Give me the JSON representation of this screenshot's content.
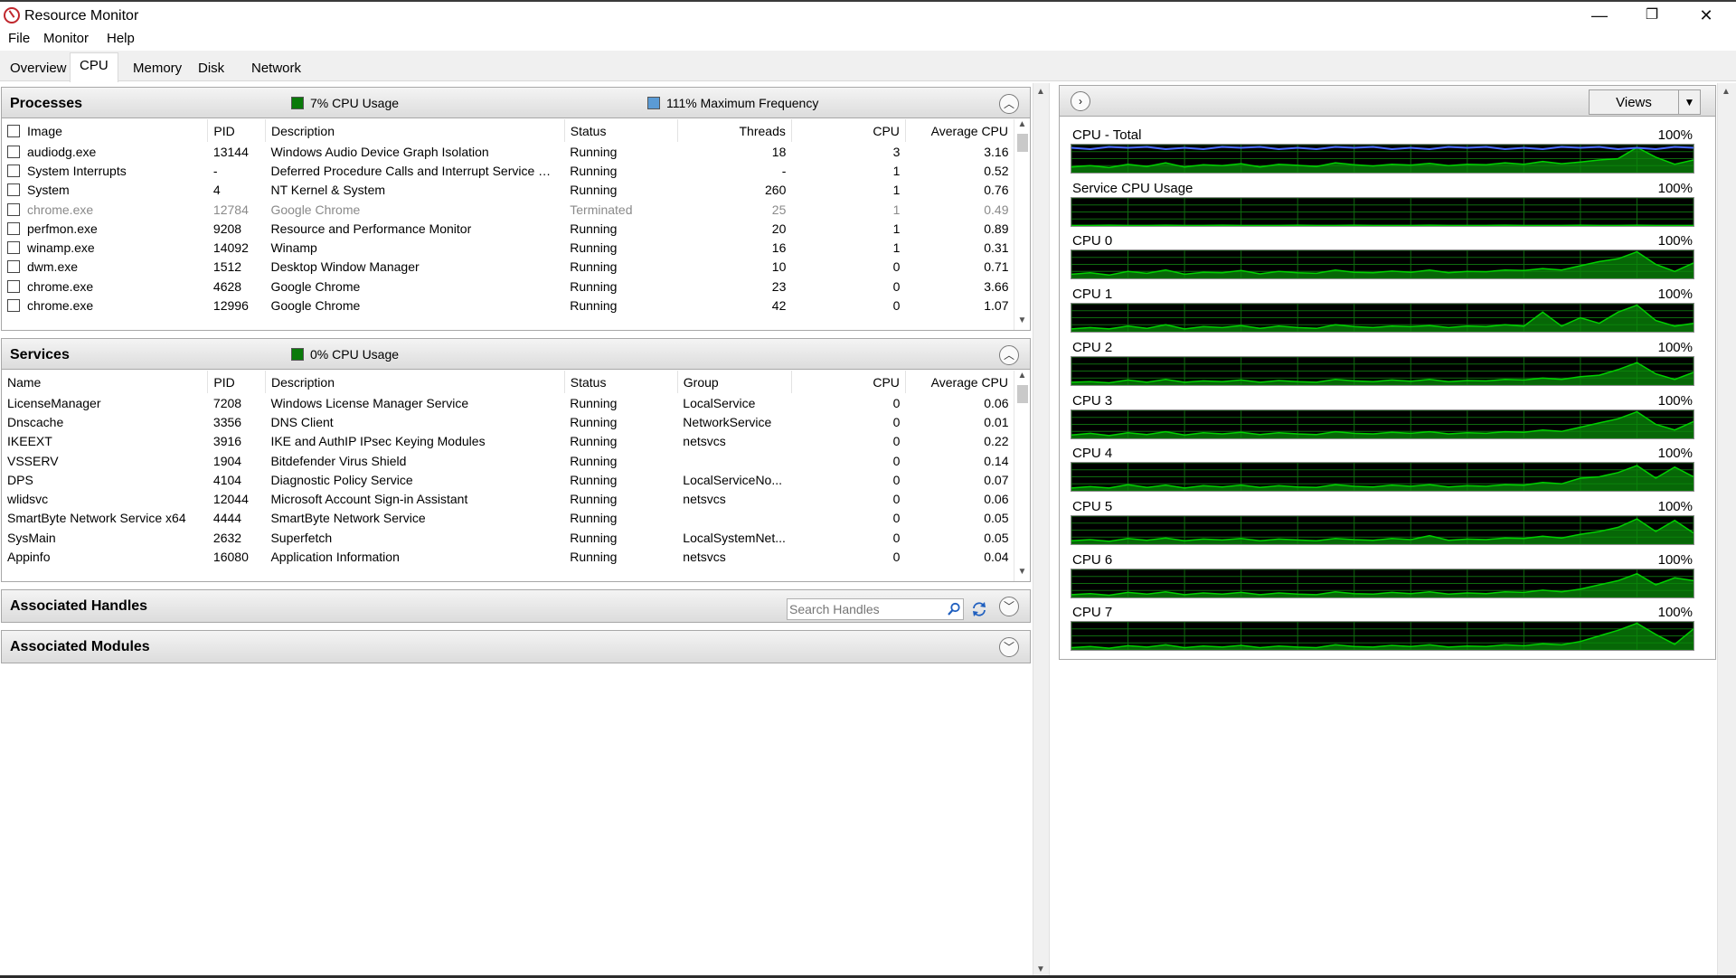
{
  "window": {
    "title": "Resource Monitor",
    "minimize": "—",
    "restore": "❐",
    "close": "✕"
  },
  "menu": [
    "File",
    "Monitor",
    "Help"
  ],
  "tabs": [
    "Overview",
    "CPU",
    "Memory",
    "Disk",
    "Network"
  ],
  "active_tab": "CPU",
  "colors": {
    "cpu_usage_box": "#0a7a0a",
    "max_freq_box": "#5b9bd5",
    "graph_line_green": "#00d000",
    "graph_line_blue": "#4a6cff",
    "graph_grid": "#0f6b0f"
  },
  "processes": {
    "title": "Processes",
    "cpu_usage": "7% CPU Usage",
    "max_frequency": "111% Maximum Frequency",
    "columns": [
      "Image",
      "PID",
      "Description",
      "Status",
      "Threads",
      "CPU",
      "Average CPU"
    ],
    "rows": [
      [
        "audiodg.exe",
        "13144",
        "Windows Audio Device Graph Isolation",
        "Running",
        "18",
        "3",
        "3.16"
      ],
      [
        "System Interrupts",
        "-",
        "Deferred Procedure Calls and Interrupt Service Rou...",
        "Running",
        "-",
        "1",
        "0.52"
      ],
      [
        "System",
        "4",
        "NT Kernel & System",
        "Running",
        "260",
        "1",
        "0.76"
      ],
      [
        "chrome.exe",
        "12784",
        "Google Chrome",
        "Terminated",
        "25",
        "1",
        "0.49"
      ],
      [
        "perfmon.exe",
        "9208",
        "Resource and Performance Monitor",
        "Running",
        "20",
        "1",
        "0.89"
      ],
      [
        "winamp.exe",
        "14092",
        "Winamp",
        "Running",
        "16",
        "1",
        "0.31"
      ],
      [
        "dwm.exe",
        "1512",
        "Desktop Window Manager",
        "Running",
        "10",
        "0",
        "0.71"
      ],
      [
        "chrome.exe",
        "4628",
        "Google Chrome",
        "Running",
        "23",
        "0",
        "3.66"
      ],
      [
        "chrome.exe",
        "12996",
        "Google Chrome",
        "Running",
        "42",
        "0",
        "1.07"
      ]
    ]
  },
  "services": {
    "title": "Services",
    "cpu_usage": "0% CPU Usage",
    "columns": [
      "Name",
      "PID",
      "Description",
      "Status",
      "Group",
      "CPU",
      "Average CPU"
    ],
    "rows": [
      [
        "LicenseManager",
        "7208",
        "Windows License Manager Service",
        "Running",
        "LocalService",
        "0",
        "0.06"
      ],
      [
        "Dnscache",
        "3356",
        "DNS Client",
        "Running",
        "NetworkService",
        "0",
        "0.01"
      ],
      [
        "IKEEXT",
        "3916",
        "IKE and AuthIP IPsec Keying Modules",
        "Running",
        "netsvcs",
        "0",
        "0.22"
      ],
      [
        "VSSERV",
        "1904",
        "Bitdefender Virus Shield",
        "Running",
        "",
        "0",
        "0.14"
      ],
      [
        "DPS",
        "4104",
        "Diagnostic Policy Service",
        "Running",
        "LocalServiceNo...",
        "0",
        "0.07"
      ],
      [
        "wlidsvc",
        "12044",
        "Microsoft Account Sign-in Assistant",
        "Running",
        "netsvcs",
        "0",
        "0.06"
      ],
      [
        "SmartByte Network Service x64",
        "4444",
        "SmartByte Network Service",
        "Running",
        "",
        "0",
        "0.05"
      ],
      [
        "SysMain",
        "2632",
        "Superfetch",
        "Running",
        "LocalSystemNet...",
        "0",
        "0.05"
      ],
      [
        "Appinfo",
        "16080",
        "Application Information",
        "Running",
        "netsvcs",
        "0",
        "0.04"
      ]
    ]
  },
  "handles": {
    "title": "Associated Handles",
    "search_placeholder": "Search Handles"
  },
  "modules": {
    "title": "Associated Modules"
  },
  "graphs": {
    "views_label": "Views",
    "items": [
      {
        "label": "CPU - Total",
        "max": "100%",
        "levels": [
          0.2,
          0.25,
          0.18,
          0.3,
          0.22,
          0.35,
          0.2,
          0.28,
          0.25,
          0.32,
          0.2,
          0.3,
          0.26,
          0.22,
          0.35,
          0.28,
          0.24,
          0.3,
          0.27,
          0.33,
          0.25,
          0.3,
          0.28,
          0.35,
          0.3,
          0.4,
          0.32,
          0.38,
          0.45,
          0.5,
          0.9,
          0.55,
          0.3,
          0.45
        ]
      },
      {
        "label": "Service CPU Usage",
        "max": "100%",
        "levels": [
          0.02,
          0.02,
          0.03,
          0.02,
          0.02,
          0.03,
          0.02,
          0.02,
          0.03,
          0.02,
          0.02,
          0.02,
          0.03,
          0.02,
          0.02,
          0.03,
          0.02,
          0.02,
          0.02,
          0.03,
          0.02,
          0.02,
          0.02,
          0.03,
          0.02,
          0.02,
          0.02,
          0.03,
          0.02,
          0.02,
          0.03,
          0.02,
          0.02,
          0.02
        ]
      },
      {
        "label": "CPU 0",
        "max": "100%",
        "levels": [
          0.15,
          0.2,
          0.12,
          0.25,
          0.18,
          0.3,
          0.15,
          0.22,
          0.2,
          0.28,
          0.16,
          0.25,
          0.2,
          0.18,
          0.3,
          0.22,
          0.2,
          0.26,
          0.22,
          0.3,
          0.2,
          0.25,
          0.24,
          0.3,
          0.28,
          0.35,
          0.3,
          0.45,
          0.6,
          0.7,
          0.95,
          0.5,
          0.25,
          0.55
        ]
      },
      {
        "label": "CPU 1",
        "max": "100%",
        "levels": [
          0.1,
          0.15,
          0.1,
          0.2,
          0.12,
          0.25,
          0.1,
          0.18,
          0.15,
          0.22,
          0.12,
          0.2,
          0.15,
          0.12,
          0.25,
          0.18,
          0.15,
          0.2,
          0.18,
          0.22,
          0.15,
          0.2,
          0.18,
          0.25,
          0.2,
          0.7,
          0.2,
          0.5,
          0.3,
          0.7,
          0.95,
          0.4,
          0.2,
          0.3
        ]
      },
      {
        "label": "CPU 2",
        "max": "100%",
        "levels": [
          0.1,
          0.12,
          0.08,
          0.18,
          0.1,
          0.2,
          0.1,
          0.15,
          0.12,
          0.18,
          0.1,
          0.16,
          0.12,
          0.1,
          0.2,
          0.15,
          0.12,
          0.18,
          0.14,
          0.2,
          0.12,
          0.16,
          0.15,
          0.2,
          0.18,
          0.25,
          0.2,
          0.3,
          0.35,
          0.55,
          0.8,
          0.4,
          0.2,
          0.45
        ]
      },
      {
        "label": "CPU 3",
        "max": "100%",
        "levels": [
          0.12,
          0.18,
          0.1,
          0.2,
          0.14,
          0.24,
          0.12,
          0.2,
          0.16,
          0.22,
          0.14,
          0.2,
          0.16,
          0.14,
          0.24,
          0.18,
          0.16,
          0.22,
          0.18,
          0.24,
          0.16,
          0.2,
          0.18,
          0.24,
          0.22,
          0.3,
          0.25,
          0.4,
          0.55,
          0.7,
          0.95,
          0.5,
          0.3,
          0.6
        ]
      },
      {
        "label": "CPU 4",
        "max": "100%",
        "levels": [
          0.1,
          0.15,
          0.1,
          0.22,
          0.12,
          0.2,
          0.1,
          0.18,
          0.14,
          0.2,
          0.12,
          0.18,
          0.14,
          0.12,
          0.22,
          0.16,
          0.14,
          0.2,
          0.16,
          0.22,
          0.14,
          0.18,
          0.16,
          0.22,
          0.2,
          0.3,
          0.25,
          0.45,
          0.5,
          0.65,
          0.9,
          0.45,
          0.85,
          0.5
        ]
      },
      {
        "label": "CPU 5",
        "max": "100%",
        "levels": [
          0.12,
          0.16,
          0.1,
          0.2,
          0.14,
          0.22,
          0.12,
          0.18,
          0.15,
          0.2,
          0.12,
          0.18,
          0.15,
          0.12,
          0.2,
          0.16,
          0.14,
          0.2,
          0.16,
          0.3,
          0.14,
          0.18,
          0.16,
          0.22,
          0.2,
          0.28,
          0.22,
          0.35,
          0.45,
          0.6,
          0.9,
          0.45,
          0.85,
          0.4
        ]
      },
      {
        "label": "CPU 6",
        "max": "100%",
        "levels": [
          0.1,
          0.14,
          0.08,
          0.18,
          0.12,
          0.2,
          0.1,
          0.16,
          0.12,
          0.18,
          0.1,
          0.16,
          0.12,
          0.1,
          0.2,
          0.14,
          0.12,
          0.18,
          0.14,
          0.2,
          0.12,
          0.16,
          0.14,
          0.2,
          0.18,
          0.26,
          0.2,
          0.3,
          0.45,
          0.6,
          0.85,
          0.45,
          0.7,
          0.6
        ]
      },
      {
        "label": "CPU 7",
        "max": "100%",
        "levels": [
          0.08,
          0.12,
          0.06,
          0.15,
          0.1,
          0.18,
          0.08,
          0.14,
          0.1,
          0.16,
          0.08,
          0.14,
          0.1,
          0.08,
          0.18,
          0.12,
          0.1,
          0.16,
          0.12,
          0.18,
          0.1,
          0.14,
          0.12,
          0.18,
          0.15,
          0.22,
          0.18,
          0.3,
          0.5,
          0.7,
          0.95,
          0.55,
          0.2,
          0.75
        ]
      }
    ]
  }
}
